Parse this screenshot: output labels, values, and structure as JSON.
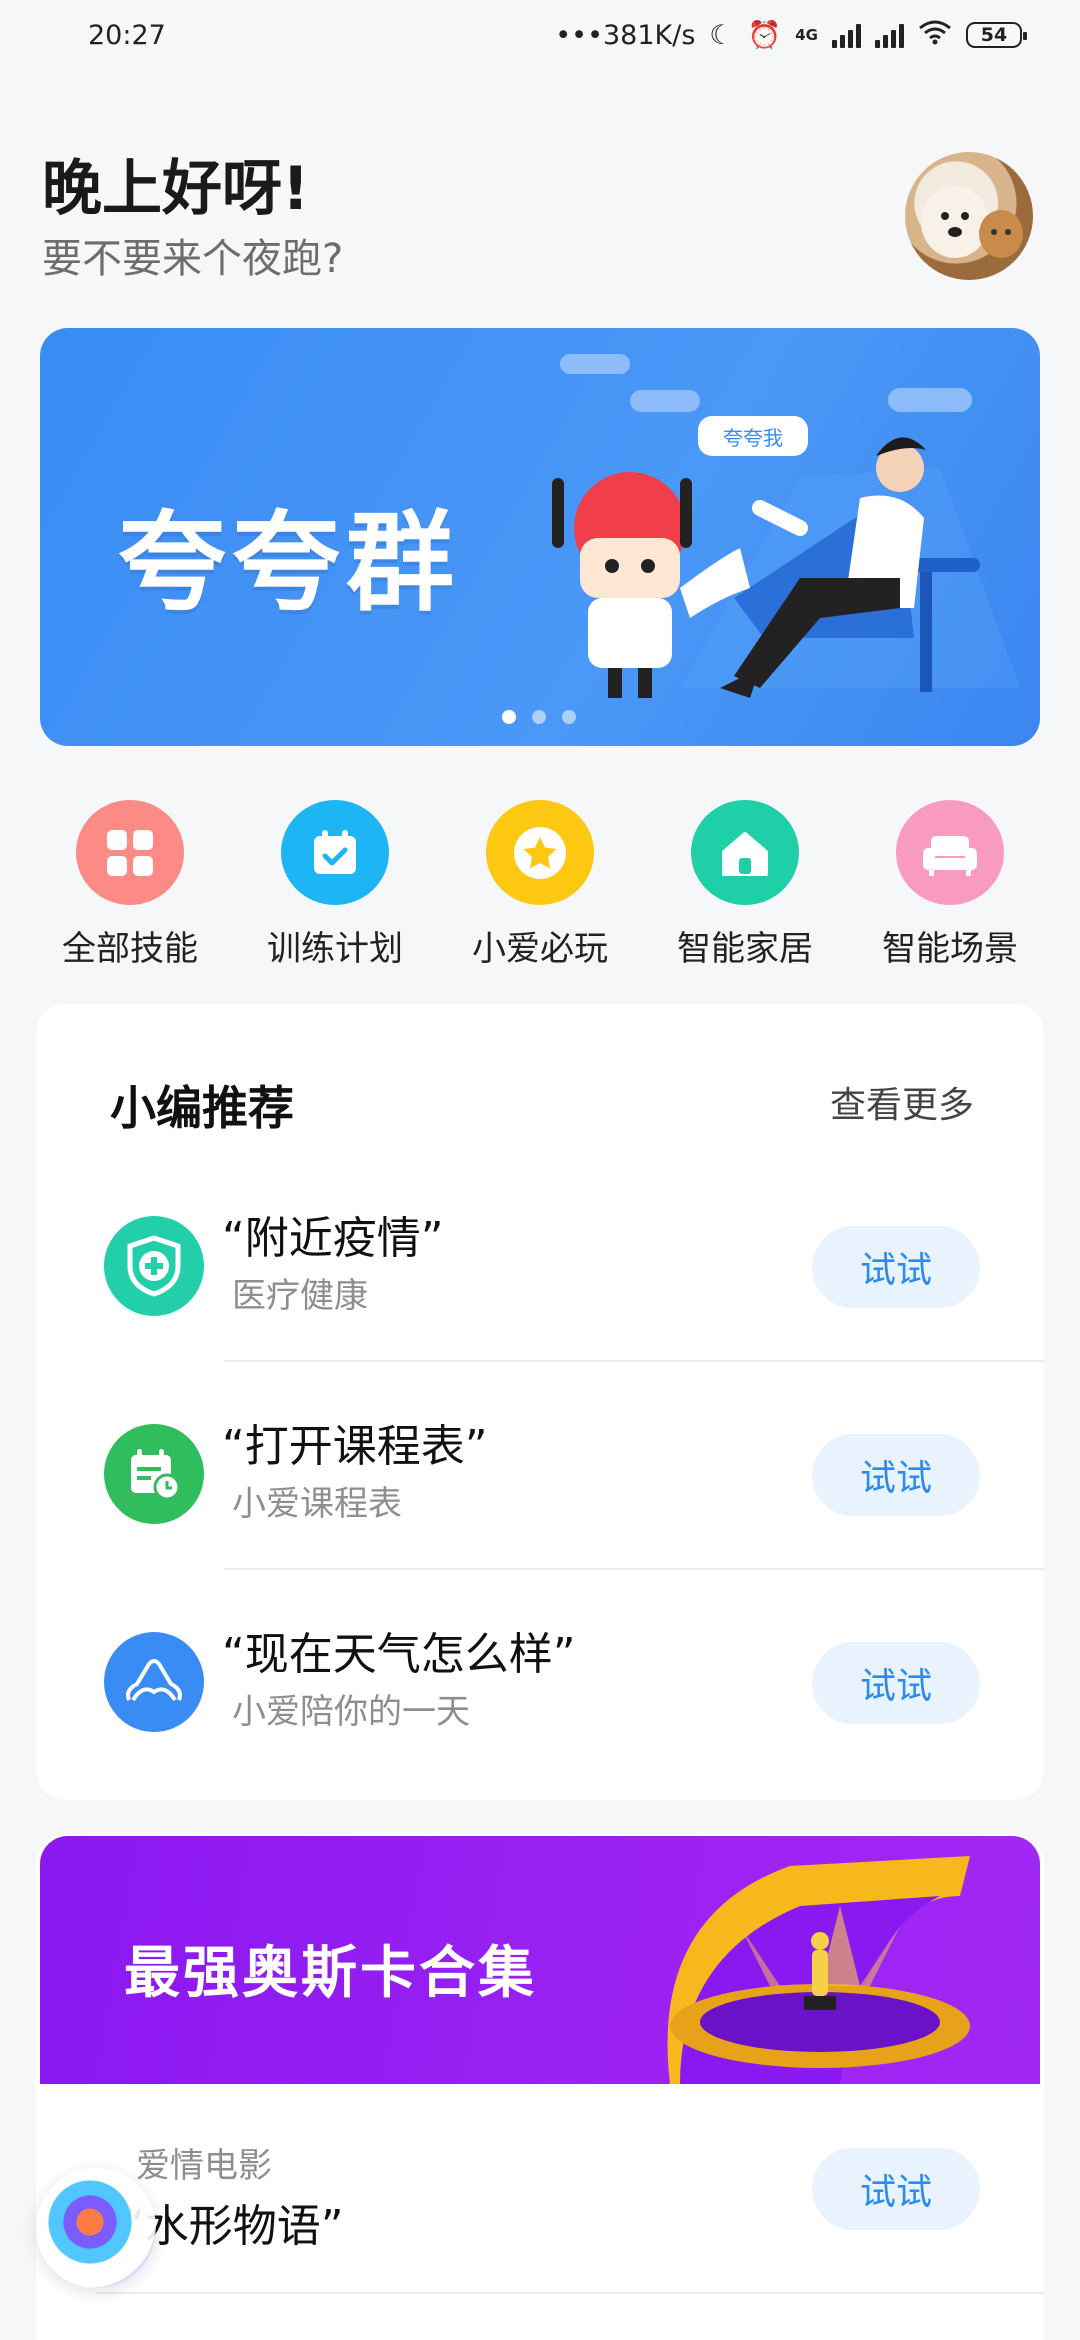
{
  "status_bar": {
    "time": "20:27",
    "speed": "•••381K/s",
    "network": "4G",
    "battery": "54"
  },
  "header": {
    "greeting": "晚上好呀!",
    "subtitle": "要不要来个夜跑?"
  },
  "banner": {
    "title": "夸夸群",
    "bubble": "夸夸我",
    "slide_count": 3,
    "active_slide": 1
  },
  "quick_actions": [
    {
      "label": "全部技能",
      "icon": "grid-icon",
      "color": "#fb8b84"
    },
    {
      "label": "训练计划",
      "icon": "calendar-check-icon",
      "color": "#1eb5f4"
    },
    {
      "label": "小爱必玩",
      "icon": "star-icon",
      "color": "#fdc812"
    },
    {
      "label": "智能家居",
      "icon": "home-icon",
      "color": "#1ecfa8"
    },
    {
      "label": "智能场景",
      "icon": "sofa-icon",
      "color": "#f99ac0"
    }
  ],
  "recommend": {
    "title": "小编推荐",
    "more": "查看更多",
    "items": [
      {
        "title": "“附近疫情”",
        "subtitle": "医疗健康",
        "button": "试试",
        "icon": "medical-shield-icon",
        "color": "#22cfa9"
      },
      {
        "title": "“打开课程表”",
        "subtitle": "小爱课程表",
        "button": "试试",
        "icon": "schedule-icon",
        "color": "#2fbd5e"
      },
      {
        "title": "“现在天气怎么样”",
        "subtitle": "小爱陪你的一天",
        "button": "试试",
        "icon": "weather-icon",
        "color": "#3a8cf5"
      }
    ]
  },
  "oscar": {
    "title": "最强奥斯卡合集",
    "genre": "爱情电影",
    "movie": "“水形物语”",
    "button": "试试"
  }
}
